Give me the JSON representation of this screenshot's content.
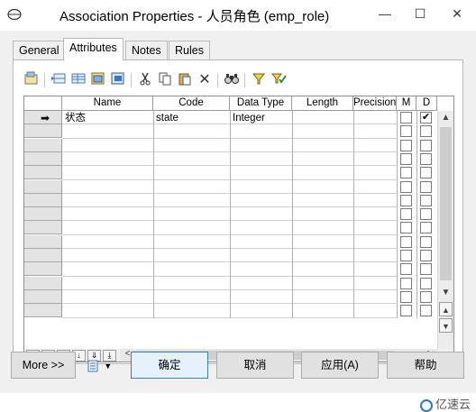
{
  "window": {
    "title": "Association Properties - 人员角色 (emp_role)",
    "minimize_glyph": "—",
    "maximize_glyph": "☐",
    "close_glyph": "✕"
  },
  "tabs": [
    {
      "label": "General",
      "active": false
    },
    {
      "label": "Attributes",
      "active": true
    },
    {
      "label": "Notes",
      "active": false
    },
    {
      "label": "Rules",
      "active": false
    }
  ],
  "toolbar": {
    "icons": [
      "properties-icon",
      "insert-row-icon",
      "add-row-icon",
      "add-attribute-icon",
      "reuse-attribute-icon",
      "cut-icon",
      "copy-icon",
      "paste-icon",
      "delete-icon",
      "find-icon",
      "filter-icon",
      "clear-filter-icon"
    ],
    "delete_glyph": "✕"
  },
  "grid": {
    "columns": [
      "Name",
      "Code",
      "Data Type",
      "Length",
      "Precision",
      "M",
      "D"
    ],
    "rows": [
      {
        "marker": "➡",
        "name": "状态",
        "code": "state",
        "data_type": "Integer",
        "length": "",
        "precision": "",
        "mandatory": false,
        "displayed": true
      }
    ],
    "check_glyph": "✔",
    "nav_glyphs": [
      "⤒",
      "⇑",
      "↑",
      "↓",
      "⇓",
      "⤓"
    ],
    "scroll_left": "<",
    "scroll_right": ">",
    "scroll_up": "▲",
    "scroll_down": "▼"
  },
  "buttons": {
    "more": "More >>",
    "ok": "确定",
    "cancel": "取消",
    "apply": "应用(A)",
    "help": "帮助",
    "menu_arrow": "▼"
  },
  "watermark": "亿速云"
}
